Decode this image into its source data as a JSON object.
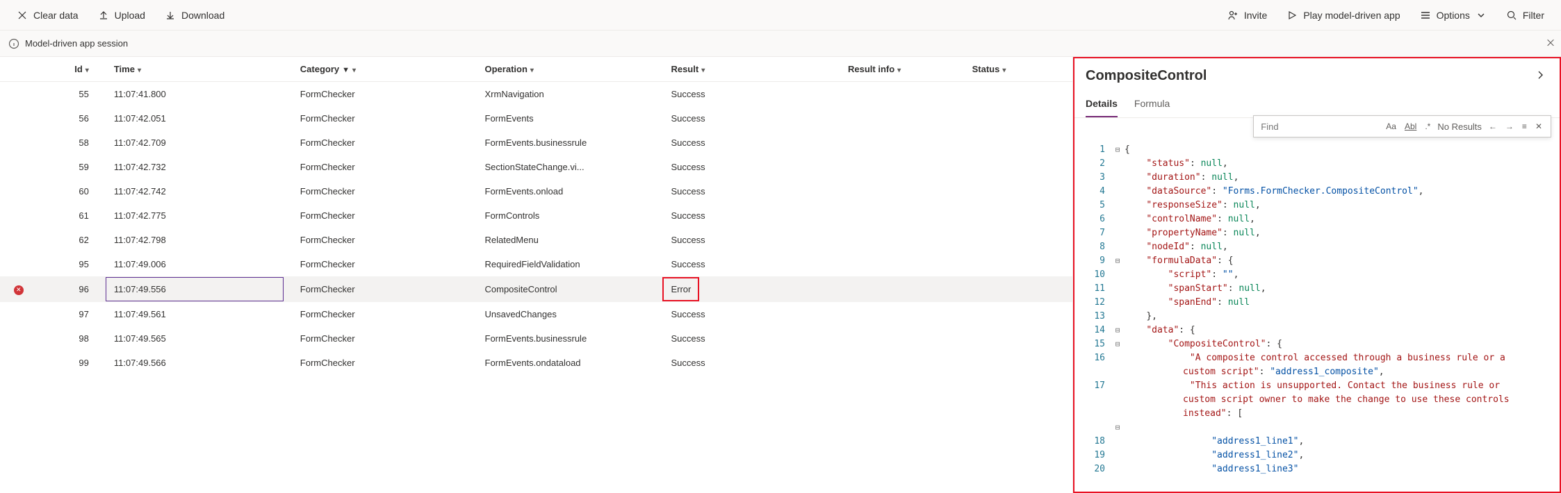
{
  "toolbar": {
    "clear": "Clear data",
    "upload": "Upload",
    "download": "Download",
    "invite": "Invite",
    "play": "Play model-driven app",
    "options": "Options",
    "filter": "Filter"
  },
  "session": {
    "label": "Model-driven app session"
  },
  "columns": {
    "id": "Id",
    "time": "Time",
    "category": "Category",
    "operation": "Operation",
    "result": "Result",
    "resultInfo": "Result info",
    "status": "Status"
  },
  "rows": [
    {
      "icon": "",
      "id": "55",
      "time": "11:07:41.800",
      "category": "FormChecker",
      "operation": "XrmNavigation",
      "result": "Success"
    },
    {
      "icon": "",
      "id": "56",
      "time": "11:07:42.051",
      "category": "FormChecker",
      "operation": "FormEvents",
      "result": "Success"
    },
    {
      "icon": "",
      "id": "58",
      "time": "11:07:42.709",
      "category": "FormChecker",
      "operation": "FormEvents.businessrule",
      "result": "Success"
    },
    {
      "icon": "",
      "id": "59",
      "time": "11:07:42.732",
      "category": "FormChecker",
      "operation": "SectionStateChange.vi...",
      "result": "Success"
    },
    {
      "icon": "",
      "id": "60",
      "time": "11:07:42.742",
      "category": "FormChecker",
      "operation": "FormEvents.onload",
      "result": "Success"
    },
    {
      "icon": "",
      "id": "61",
      "time": "11:07:42.775",
      "category": "FormChecker",
      "operation": "FormControls",
      "result": "Success"
    },
    {
      "icon": "",
      "id": "62",
      "time": "11:07:42.798",
      "category": "FormChecker",
      "operation": "RelatedMenu",
      "result": "Success"
    },
    {
      "icon": "",
      "id": "95",
      "time": "11:07:49.006",
      "category": "FormChecker",
      "operation": "RequiredFieldValidation",
      "result": "Success"
    },
    {
      "icon": "error",
      "id": "96",
      "time": "11:07:49.556",
      "category": "FormChecker",
      "operation": "CompositeControl",
      "result": "Error",
      "selected": true
    },
    {
      "icon": "",
      "id": "97",
      "time": "11:07:49.561",
      "category": "FormChecker",
      "operation": "UnsavedChanges",
      "result": "Success"
    },
    {
      "icon": "",
      "id": "98",
      "time": "11:07:49.565",
      "category": "FormChecker",
      "operation": "FormEvents.businessrule",
      "result": "Success"
    },
    {
      "icon": "",
      "id": "99",
      "time": "11:07:49.566",
      "category": "FormChecker",
      "operation": "FormEvents.ondataload",
      "result": "Success"
    }
  ],
  "panel": {
    "title": "CompositeControl",
    "tabs": {
      "details": "Details",
      "formula": "Formula"
    },
    "find": {
      "placeholder": "Find",
      "results": "No Results"
    },
    "code": [
      {
        "ln": "1",
        "fold": "⊟",
        "indent": 0,
        "tokens": [
          [
            "c",
            "{"
          ]
        ]
      },
      {
        "ln": "2",
        "fold": "",
        "indent": 1,
        "tokens": [
          [
            "k",
            "\"status\""
          ],
          [
            "c",
            ": "
          ],
          [
            "n",
            "null"
          ],
          [
            "c",
            ","
          ]
        ]
      },
      {
        "ln": "3",
        "fold": "",
        "indent": 1,
        "tokens": [
          [
            "k",
            "\"duration\""
          ],
          [
            "c",
            ": "
          ],
          [
            "n",
            "null"
          ],
          [
            "c",
            ","
          ]
        ]
      },
      {
        "ln": "4",
        "fold": "",
        "indent": 1,
        "tokens": [
          [
            "k",
            "\"dataSource\""
          ],
          [
            "c",
            ": "
          ],
          [
            "s",
            "\"Forms.FormChecker.CompositeControl\""
          ],
          [
            "c",
            ","
          ]
        ]
      },
      {
        "ln": "5",
        "fold": "",
        "indent": 1,
        "tokens": [
          [
            "k",
            "\"responseSize\""
          ],
          [
            "c",
            ": "
          ],
          [
            "n",
            "null"
          ],
          [
            "c",
            ","
          ]
        ]
      },
      {
        "ln": "6",
        "fold": "",
        "indent": 1,
        "tokens": [
          [
            "k",
            "\"controlName\""
          ],
          [
            "c",
            ": "
          ],
          [
            "n",
            "null"
          ],
          [
            "c",
            ","
          ]
        ]
      },
      {
        "ln": "7",
        "fold": "",
        "indent": 1,
        "tokens": [
          [
            "k",
            "\"propertyName\""
          ],
          [
            "c",
            ": "
          ],
          [
            "n",
            "null"
          ],
          [
            "c",
            ","
          ]
        ]
      },
      {
        "ln": "8",
        "fold": "",
        "indent": 1,
        "tokens": [
          [
            "k",
            "\"nodeId\""
          ],
          [
            "c",
            ": "
          ],
          [
            "n",
            "null"
          ],
          [
            "c",
            ","
          ]
        ]
      },
      {
        "ln": "9",
        "fold": "⊟",
        "indent": 1,
        "tokens": [
          [
            "k",
            "\"formulaData\""
          ],
          [
            "c",
            ": {"
          ]
        ]
      },
      {
        "ln": "10",
        "fold": "",
        "indent": 2,
        "tokens": [
          [
            "k",
            "\"script\""
          ],
          [
            "c",
            ": "
          ],
          [
            "s",
            "\"\""
          ],
          [
            "c",
            ","
          ]
        ]
      },
      {
        "ln": "11",
        "fold": "",
        "indent": 2,
        "tokens": [
          [
            "k",
            "\"spanStart\""
          ],
          [
            "c",
            ": "
          ],
          [
            "n",
            "null"
          ],
          [
            "c",
            ","
          ]
        ]
      },
      {
        "ln": "12",
        "fold": "",
        "indent": 2,
        "tokens": [
          [
            "k",
            "\"spanEnd\""
          ],
          [
            "c",
            ": "
          ],
          [
            "n",
            "null"
          ]
        ]
      },
      {
        "ln": "13",
        "fold": "",
        "indent": 1,
        "tokens": [
          [
            "c",
            "},"
          ]
        ]
      },
      {
        "ln": "14",
        "fold": "⊟",
        "indent": 1,
        "tokens": [
          [
            "k",
            "\"data\""
          ],
          [
            "c",
            ": {"
          ]
        ]
      },
      {
        "ln": "15",
        "fold": "⊟",
        "indent": 2,
        "tokens": [
          [
            "k",
            "\"CompositeControl\""
          ],
          [
            "c",
            ": {"
          ]
        ]
      },
      {
        "ln": "16",
        "fold": "",
        "indent": 3,
        "wrap": true,
        "tokens": [
          [
            "k",
            "\"A composite control accessed through a business rule or a custom script\""
          ],
          [
            "c",
            ": "
          ],
          [
            "s",
            "\"address1_composite\""
          ],
          [
            "c",
            ","
          ]
        ]
      },
      {
        "ln": "17",
        "fold": "",
        "indent": 3,
        "wrap": true,
        "tokens": [
          [
            "k",
            "\"This action is unsupported. Contact the business rule or custom script owner to make the change to use these controls instead\""
          ],
          [
            "c",
            ": ["
          ]
        ]
      },
      {
        "ln": "",
        "fold": "⊟",
        "indent": 0,
        "tokens": []
      },
      {
        "ln": "18",
        "fold": "",
        "indent": 4,
        "tokens": [
          [
            "s",
            "\"address1_line1\""
          ],
          [
            "c",
            ","
          ]
        ]
      },
      {
        "ln": "19",
        "fold": "",
        "indent": 4,
        "tokens": [
          [
            "s",
            "\"address1_line2\""
          ],
          [
            "c",
            ","
          ]
        ]
      },
      {
        "ln": "20",
        "fold": "",
        "indent": 4,
        "tokens": [
          [
            "s",
            "\"address1_line3\""
          ]
        ]
      }
    ]
  }
}
